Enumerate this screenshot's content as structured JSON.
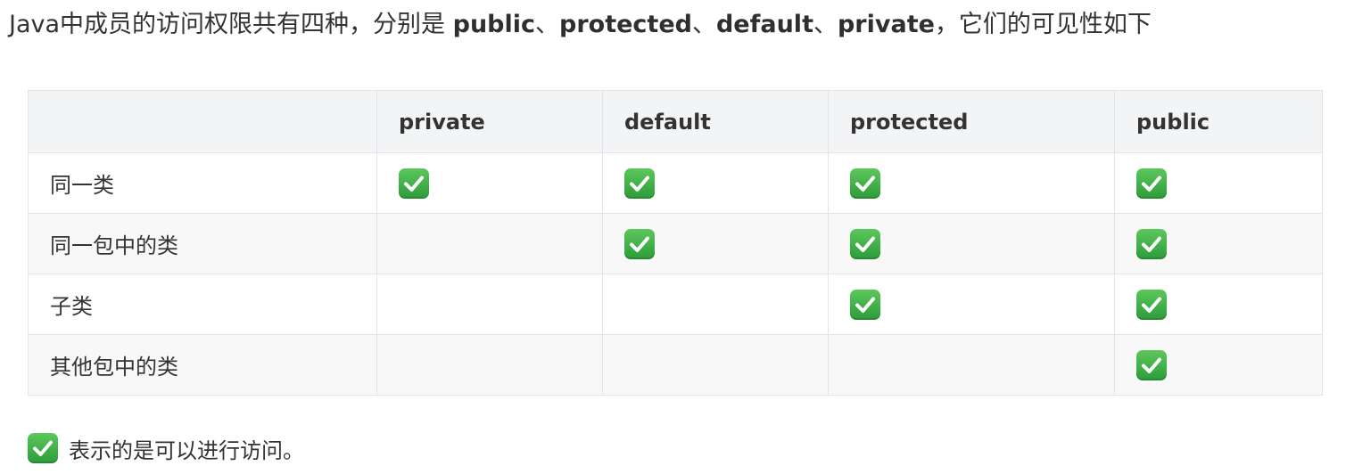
{
  "intro": {
    "prefix": "Java中成员的访问权限共有四种，分别是 ",
    "kw1": "public",
    "sep1": "、",
    "kw2": "protected",
    "sep2": "、",
    "kw3": "default",
    "sep3": "、",
    "kw4": "private",
    "suffix": "，它们的可见性如下"
  },
  "table": {
    "columns": [
      "",
      "private",
      "default",
      "protected",
      "public"
    ],
    "rows": [
      {
        "label": "同一类",
        "access": [
          true,
          true,
          true,
          true
        ]
      },
      {
        "label": "同一包中的类",
        "access": [
          false,
          true,
          true,
          true
        ]
      },
      {
        "label": "子类",
        "access": [
          false,
          false,
          true,
          true
        ]
      },
      {
        "label": "其他包中的类",
        "access": [
          false,
          false,
          false,
          true
        ]
      }
    ]
  },
  "legend": {
    "icon": "check-mark-icon",
    "text": "表示的是可以进行访问。"
  },
  "colors": {
    "check_green": "#3eb24b",
    "header_bg": "#f3f4f5",
    "border": "#e2e4e7"
  }
}
